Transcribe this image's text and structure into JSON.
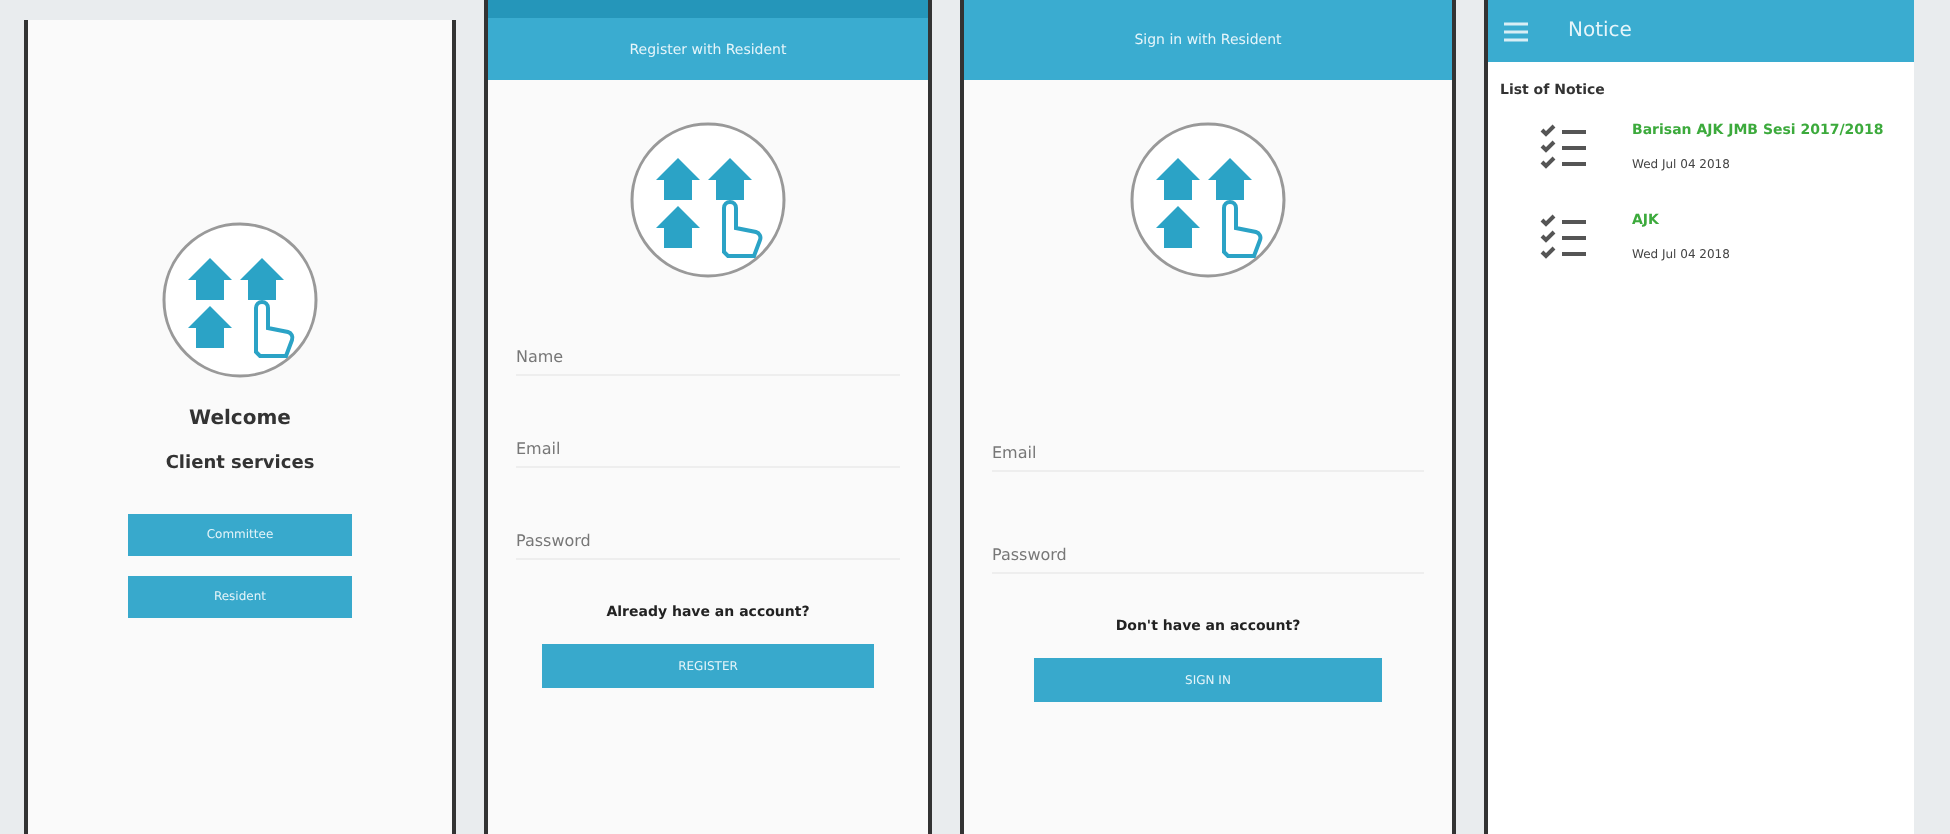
{
  "screens": [
    {
      "kind": "welcome",
      "title": "Welcome",
      "subtitle": "Client services",
      "buttons": [
        "Committee",
        "Resident"
      ]
    },
    {
      "kind": "form",
      "header": "Register with Resident",
      "fields": [
        {
          "placeholder": "Name"
        },
        {
          "placeholder": "Email"
        },
        {
          "placeholder": "Password"
        }
      ],
      "prompt": "Already have an account?",
      "button": "REGISTER"
    },
    {
      "kind": "form",
      "header": "Sign in with Resident",
      "fields": [
        {
          "placeholder": "Email"
        },
        {
          "placeholder": "Password"
        }
      ],
      "prompt": "Don't have an account?",
      "button": "SIGN IN"
    },
    {
      "kind": "list",
      "header": "Notice",
      "list_title": "List of Notice",
      "items": [
        {
          "title": "Barisan AJK JMB Sesi 2017/2018",
          "date": "Wed Jul 04 2018"
        },
        {
          "title": "AJK",
          "date": "Wed Jul 04 2018"
        }
      ]
    }
  ]
}
